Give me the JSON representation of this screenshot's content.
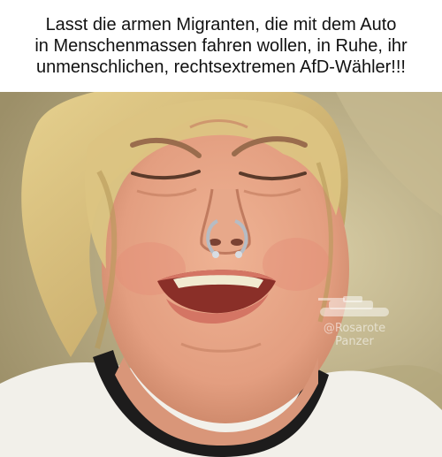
{
  "caption": {
    "line1": "Lasst die armen Migranten, die mit dem Auto",
    "line2": "in Menschenmassen fahren wollen, in Ruhe, ihr",
    "line3": "unmenschlichen, rechtsextremen AfD-Wähler!!!"
  },
  "watermark": {
    "handle": "@Rosarote",
    "name": "Panzer",
    "icon": "tank-icon"
  },
  "photo": {
    "subject": "crying-face",
    "colors": {
      "background": "#b9ad86",
      "skin": "#e7a88a",
      "hair": "#d8c07e",
      "shirt": "#f2f0ea",
      "collar": "#1d1c1c",
      "piercing": "#b6bcc4"
    }
  }
}
